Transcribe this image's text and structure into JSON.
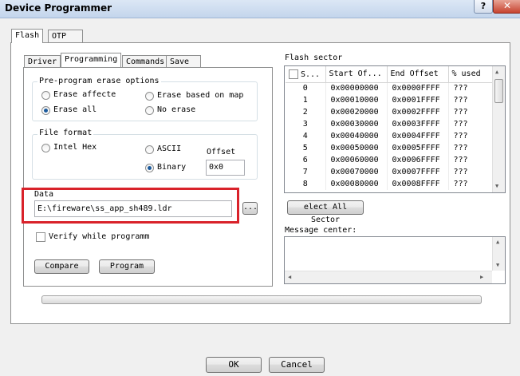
{
  "window": {
    "title": "Device Programmer",
    "help_label": "?",
    "close_label": "✕"
  },
  "outer_tabs": [
    {
      "label": "Flash"
    },
    {
      "label": "OTP"
    }
  ],
  "inner_tabs": [
    {
      "label": "Driver"
    },
    {
      "label": "Programming"
    },
    {
      "label": "Commands"
    },
    {
      "label": "Save"
    }
  ],
  "preprogram": {
    "title": "Pre-program erase options",
    "options": [
      {
        "label": "Erase affecte",
        "selected": false
      },
      {
        "label": "Erase based on map",
        "selected": false
      },
      {
        "label": "Erase all",
        "selected": true
      },
      {
        "label": "No erase",
        "selected": false
      }
    ]
  },
  "file_format": {
    "title": "File format",
    "options": [
      {
        "label": "Intel Hex",
        "selected": false
      },
      {
        "label": "ASCII",
        "selected": false
      },
      {
        "label": "Binary",
        "selected": true
      }
    ],
    "offset_label": "Offset",
    "offset_value": "0x0"
  },
  "data": {
    "title": "Data",
    "path": "E:\\fireware\\ss_app_sh489.ldr",
    "browse_label": "..."
  },
  "verify": {
    "label": "Verify while programm",
    "checked": false
  },
  "buttons": {
    "compare": "Compare",
    "program": "Program",
    "ok": "OK",
    "cancel": "Cancel",
    "select_all": "elect All Sector"
  },
  "flash_sector": {
    "title": "Flash sector",
    "columns": [
      "S...",
      "Start Of...",
      "End Offset",
      "% used"
    ],
    "rows": [
      {
        "s": "0",
        "start": "0x00000000",
        "end": "0x0000FFFF",
        "used": "???"
      },
      {
        "s": "1",
        "start": "0x00010000",
        "end": "0x0001FFFF",
        "used": "???"
      },
      {
        "s": "2",
        "start": "0x00020000",
        "end": "0x0002FFFF",
        "used": "???"
      },
      {
        "s": "3",
        "start": "0x00030000",
        "end": "0x0003FFFF",
        "used": "???"
      },
      {
        "s": "4",
        "start": "0x00040000",
        "end": "0x0004FFFF",
        "used": "???"
      },
      {
        "s": "5",
        "start": "0x00050000",
        "end": "0x0005FFFF",
        "used": "???"
      },
      {
        "s": "6",
        "start": "0x00060000",
        "end": "0x0006FFFF",
        "used": "???"
      },
      {
        "s": "7",
        "start": "0x00070000",
        "end": "0x0007FFFF",
        "used": "???"
      },
      {
        "s": "8",
        "start": "0x00080000",
        "end": "0x0008FFFF",
        "used": "???"
      }
    ]
  },
  "message_center": {
    "title": "Message center:",
    "text": ""
  },
  "colors": {
    "highlight_box": "#d9222a",
    "title_bar": "#c3d5ec",
    "radio_dot": "#1c5a9c"
  }
}
